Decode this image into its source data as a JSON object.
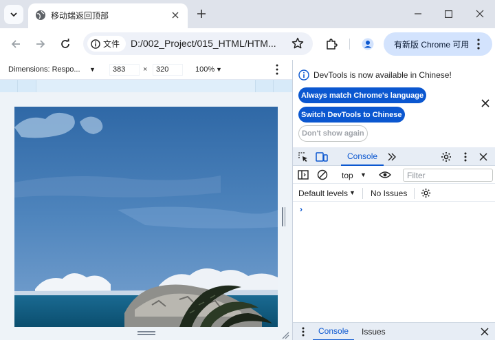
{
  "browser": {
    "tab_title": "移动端返回顶部",
    "url": "D:/002_Project/015_HTML/HTM...",
    "site_chip_label": "文件",
    "update_button_label": "有新版 Chrome 可用"
  },
  "device_toolbar": {
    "dimensions_label": "Dimensions: Respo...",
    "width": "383",
    "times": "×",
    "height": "320",
    "zoom": "100%"
  },
  "devtools": {
    "banner": {
      "message": "DevTools is now available in Chinese!",
      "match_language_label": "Always match Chrome's language",
      "switch_label": "Switch DevTools to Chinese",
      "dont_show_label": "Don't show again"
    },
    "tabs": {
      "active": "Console"
    },
    "console_toolbar": {
      "context": "top",
      "filter_placeholder": "Filter",
      "levels_label": "Default levels",
      "issues_label": "No Issues"
    },
    "prompt_symbol": "›",
    "drawer": {
      "console_label": "Console",
      "issues_label": "Issues"
    }
  },
  "colors": {
    "accent": "#0b57d0",
    "tabstrip": "#dfe3eb",
    "update_chip": "#d3e3fd",
    "sky": "#3e73ad",
    "sea": "#0d5a7f"
  },
  "icons": [
    "chevron-down-icon",
    "globe-icon",
    "close-icon",
    "plus-icon",
    "minimize-icon",
    "maximize-icon",
    "back-icon",
    "forward-icon",
    "reload-icon",
    "info-icon",
    "star-icon",
    "extensions-icon",
    "profile-icon",
    "more-vert-icon",
    "inspect-icon",
    "device-toggle-icon",
    "more-tabs-icon",
    "gear-icon",
    "sidebar-icon",
    "clear-icon",
    "eye-icon"
  ]
}
